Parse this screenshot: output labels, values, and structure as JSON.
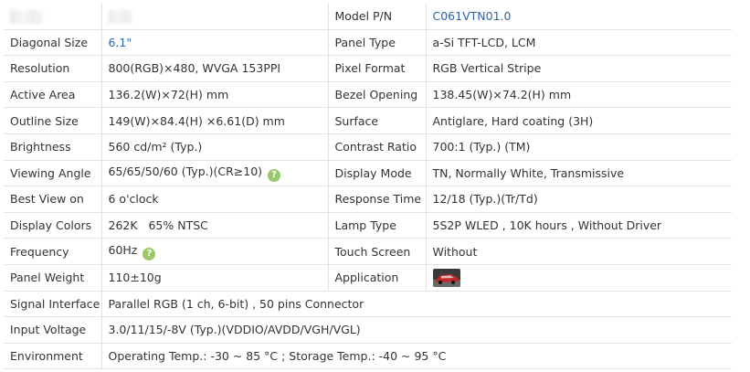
{
  "rows": [
    {
      "l1": "",
      "v1": "",
      "l2": "Model P/N",
      "v2": "C061VTN01.0"
    },
    {
      "l1": "Diagonal Size",
      "v1": "6.1\"",
      "l2": "Panel Type",
      "v2": "a-Si TFT-LCD, LCM"
    },
    {
      "l1": "Resolution",
      "v1": "800(RGB)×480, WVGA  153PPI",
      "l2": "Pixel Format",
      "v2": "RGB Vertical Stripe"
    },
    {
      "l1": "Active Area",
      "v1": "136.2(W)×72(H) mm",
      "l2": "Bezel Opening",
      "v2": "138.45(W)×74.2(H) mm"
    },
    {
      "l1": "Outline Size",
      "v1": "149(W)×84.4(H) ×6.61(D) mm",
      "l2": "Surface",
      "v2": "Antiglare, Hard coating (3H)"
    },
    {
      "l1": "Brightness",
      "v1": "560 cd/m² (Typ.)",
      "l2": "Contrast Ratio",
      "v2": "700:1 (Typ.) (TM)"
    },
    {
      "l1": "Viewing Angle",
      "v1": "65/65/50/60 (Typ.)(CR≥10)",
      "l2": "Display Mode",
      "v2": "TN, Normally White, Transmissive"
    },
    {
      "l1": "Best View on",
      "v1": "6 o'clock",
      "l2": "Response Time",
      "v2": "12/18 (Typ.)(Tr/Td)"
    },
    {
      "l1": "Display Colors",
      "v1": "262K   65% NTSC",
      "l2": "Lamp Type",
      "v2": "5S2P WLED , 10K hours , Without Driver"
    },
    {
      "l1": "Frequency",
      "v1": "60Hz",
      "l2": "Touch Screen",
      "v2": "Without"
    },
    {
      "l1": "Panel Weight",
      "v1": "110±10g",
      "l2": "Application",
      "v2": ""
    }
  ],
  "wide_rows": [
    {
      "label": "Signal Interface",
      "value": "Parallel RGB (1 ch, 6-bit) , 50 pins Connector"
    },
    {
      "label": "Input Voltage",
      "value": "3.0/11/15/-8V (Typ.)(VDDIO/AVDD/VGH/VGL)"
    },
    {
      "label": "Environment",
      "value": "Operating Temp.: -30 ~ 85 °C ; Storage Temp.: -40 ~ 95 °C"
    }
  ],
  "help_icon_glyph": "?",
  "colors": {
    "link": "#2c64a8",
    "help_icon": "#9bc86a",
    "border": "#e2e2e2",
    "text": "#333333"
  }
}
